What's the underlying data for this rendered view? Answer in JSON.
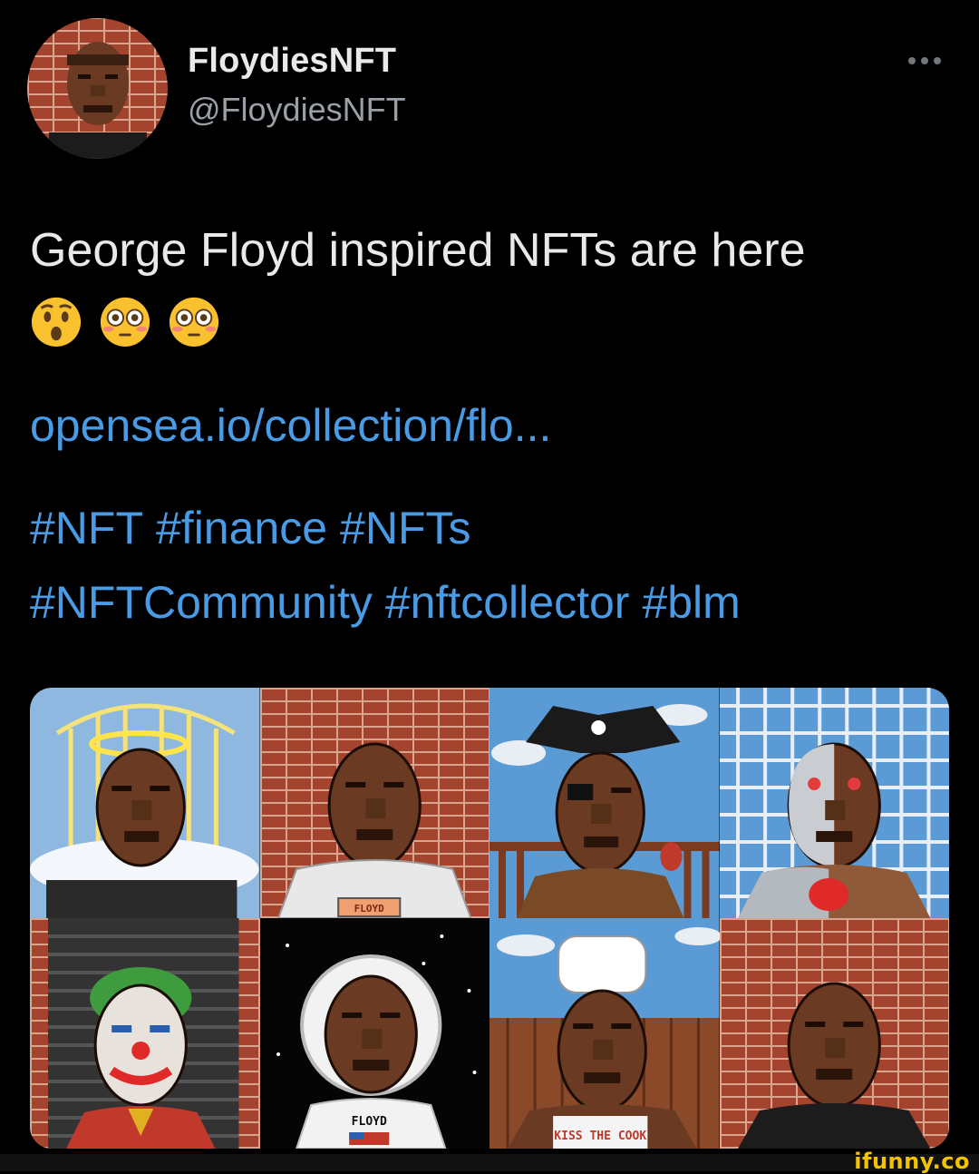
{
  "profile": {
    "display_name": "FloydiesNFT",
    "handle": "@FloydiesNFT"
  },
  "tweet": {
    "text": "George Floyd inspired NFTs are here",
    "emojis": [
      "hushed-face",
      "flushed-face",
      "flushed-face"
    ],
    "link_text": "opensea.io/collection/flo...",
    "hashtags": [
      "#NFT",
      "#finance",
      "#NFTs",
      "#NFTCommunity",
      "#nftcollector",
      "#blm"
    ]
  },
  "nft_images": {
    "labels": [
      "FLOYD",
      "FLOYD",
      "KISS THE COOK"
    ],
    "tiles": [
      {
        "name": "angel-halo-nft"
      },
      {
        "name": "floyd-shirt-nft"
      },
      {
        "name": "pirate-nft"
      },
      {
        "name": "cyborg-nft"
      },
      {
        "name": "joker-nft"
      },
      {
        "name": "astronaut-nft"
      },
      {
        "name": "chef-nft"
      },
      {
        "name": "brick-wall-nft"
      }
    ]
  },
  "watermark": "ifunny.co",
  "colors": {
    "background": "#000000",
    "text": "#e7e9ea",
    "secondary_text": "#9aa0a6",
    "link": "#4a9be5",
    "watermark": "#f4c300",
    "skin": "#6b3a22",
    "brick": "#a4432e",
    "sky": "#5b9bd5"
  }
}
